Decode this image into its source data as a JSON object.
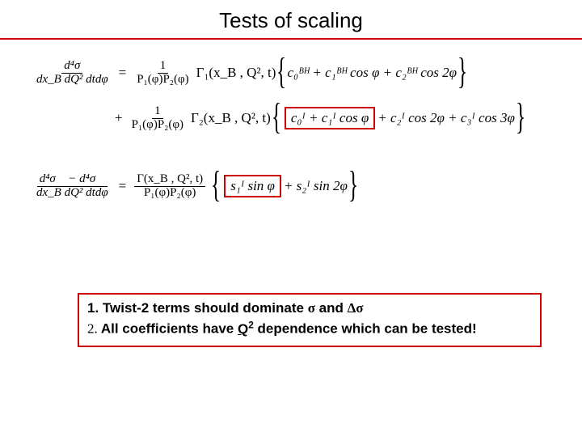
{
  "title": "Tests of scaling",
  "eq": {
    "lhs1_num": "d⁴σ",
    "lhs1_den": "dx_B dQ² dtdφ",
    "one": "1",
    "prop": "P₁(φ)P₂(φ)",
    "gamma1": "Γ₁(x_B , Q², t)",
    "bh_terms": "c₀ᴮᴴ + c₁ᴮᴴ cos φ + c₂ᴮᴴ cos 2φ",
    "plus": "+",
    "gamma2": "Γ₂(x_B , Q², t)",
    "i_box": "c₀ᴵ + c₁ᴵ cos φ",
    "i_rest": "+ c₂ᴵ cos 2φ + c₃ᴵ cos 3φ",
    "lhs2_num": "d⁴σ⃗ − d⁴σ⃖",
    "lhs2_den": "dx_B dQ² dtdφ",
    "gamma": "Γ(x_B , Q², t)",
    "s_box": "s₁ᴵ  sin φ",
    "s_rest": "+ s₂ᴵ sin 2φ",
    "eq_sign": "="
  },
  "notes": {
    "line1_a": "1. Twist-2 terms should dominate ",
    "line1_sigma": "σ",
    "line1_and": " and ",
    "line1_delta": "Δσ",
    "line2_a": "2.",
    "line2_b": " All coefficients have ",
    "line2_q": "Q",
    "line2_sup": "2",
    "line2_c": " dependence which can be tested!"
  }
}
